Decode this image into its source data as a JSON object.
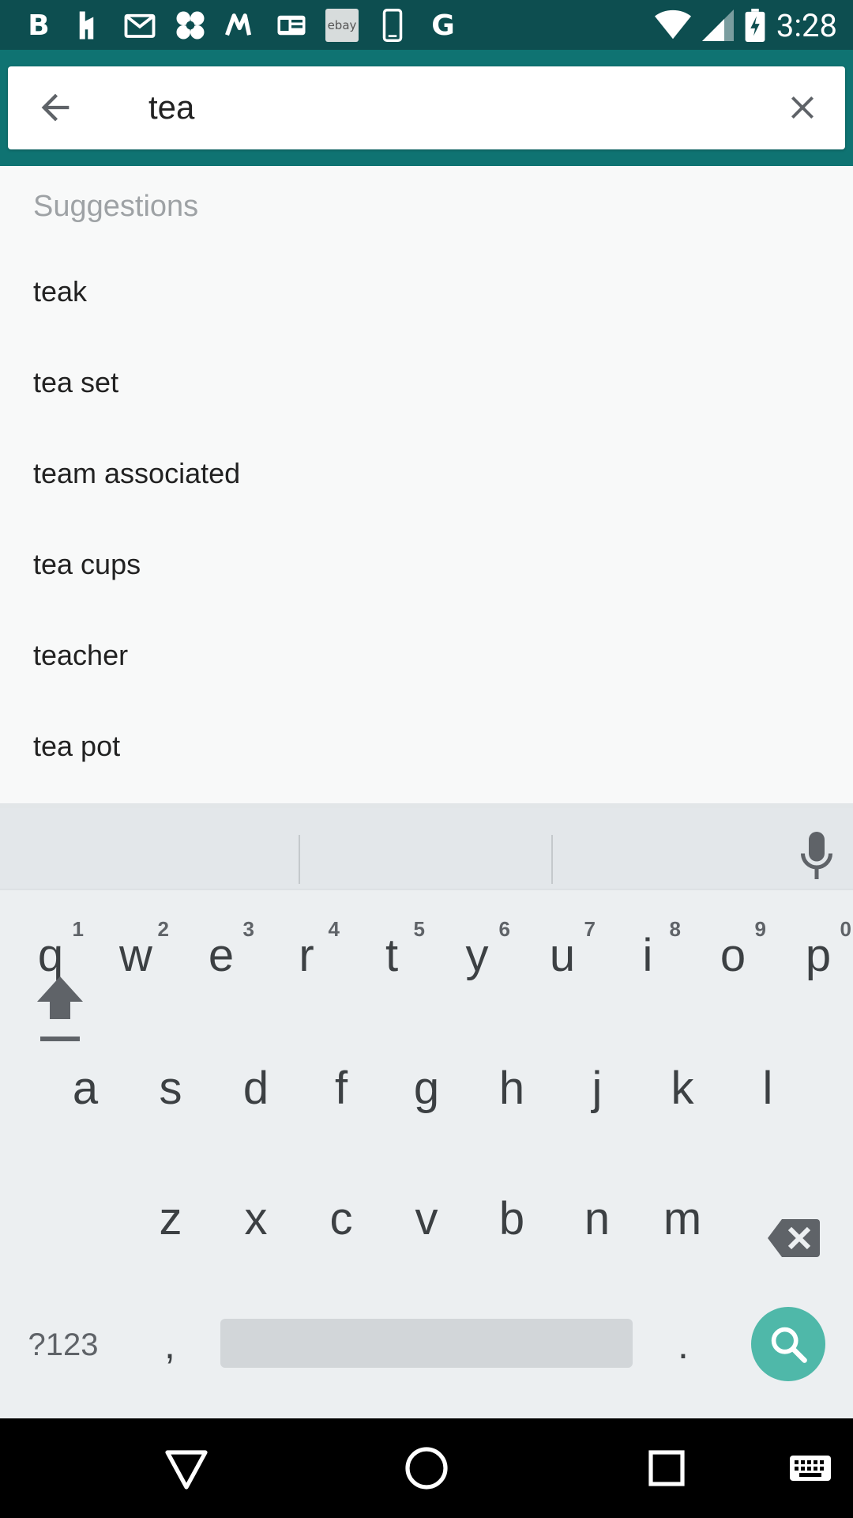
{
  "status_bar": {
    "time": "3:28",
    "left_icons": [
      "b-app-icon",
      "houzz-icon",
      "gmail-icon",
      "dice-app-icon",
      "m-app-icon",
      "news-icon",
      "ebay-icon",
      "phone-icon",
      "google-icon"
    ],
    "right_icons": [
      "wifi-icon",
      "signal-icon",
      "battery-charging-icon"
    ],
    "ebay_text": "ebay",
    "b_text": "B",
    "g_text": "G"
  },
  "search": {
    "query": "tea"
  },
  "suggestions": {
    "header": "Suggestions",
    "items": [
      "teak",
      "tea set",
      "team associated",
      "tea cups",
      "teacher",
      "tea pot"
    ]
  },
  "keyboard": {
    "row1": [
      {
        "letter": "q",
        "num": "1"
      },
      {
        "letter": "w",
        "num": "2"
      },
      {
        "letter": "e",
        "num": "3"
      },
      {
        "letter": "r",
        "num": "4"
      },
      {
        "letter": "t",
        "num": "5"
      },
      {
        "letter": "y",
        "num": "6"
      },
      {
        "letter": "u",
        "num": "7"
      },
      {
        "letter": "i",
        "num": "8"
      },
      {
        "letter": "o",
        "num": "9"
      },
      {
        "letter": "p",
        "num": "0"
      }
    ],
    "row2": [
      "a",
      "s",
      "d",
      "f",
      "g",
      "h",
      "j",
      "k",
      "l"
    ],
    "row3": [
      "z",
      "x",
      "c",
      "v",
      "b",
      "n",
      "m"
    ],
    "symbols_label": "?123",
    "comma_label": ",",
    "period_label": "."
  },
  "colors": {
    "status_bar": "#0d4e50",
    "app_bar": "#0f7372",
    "search_action": "#4fb8a9"
  }
}
